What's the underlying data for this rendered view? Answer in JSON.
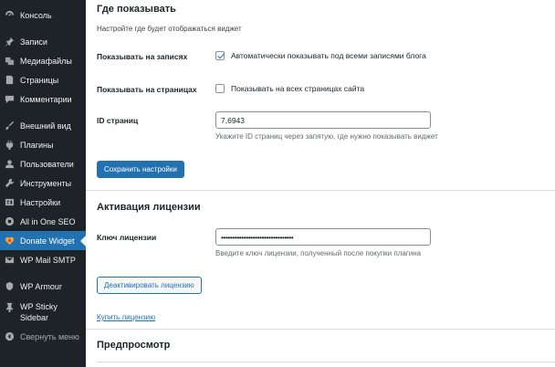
{
  "sidebar": {
    "items": [
      {
        "label": "Консоль",
        "icon": "dashboard-icon"
      },
      {
        "label": "Записи",
        "icon": "pin-icon"
      },
      {
        "label": "Медиафайлы",
        "icon": "media-icon"
      },
      {
        "label": "Страницы",
        "icon": "page-icon"
      },
      {
        "label": "Комментарии",
        "icon": "comment-icon"
      },
      {
        "label": "Внешний вид",
        "icon": "brush-icon"
      },
      {
        "label": "Плагины",
        "icon": "plugin-icon"
      },
      {
        "label": "Пользователи",
        "icon": "users-icon"
      },
      {
        "label": "Инструменты",
        "icon": "wrench-icon"
      },
      {
        "label": "Настройки",
        "icon": "settings-icon"
      },
      {
        "label": "All in One SEO",
        "icon": "seo-icon"
      },
      {
        "label": "Donate Widget",
        "icon": "heart-icon"
      },
      {
        "label": "WP Mail SMTP",
        "icon": "mail-icon"
      },
      {
        "label": "WP Armour",
        "icon": "shield-icon"
      },
      {
        "label": "WP Sticky Sidebar",
        "icon": "sticky-pin-icon"
      },
      {
        "label": "Свернуть меню",
        "icon": "collapse-icon"
      }
    ]
  },
  "display_section": {
    "title": "Где показывать",
    "description": "Настройте где будет отображаться виджет",
    "posts_label": "Показывать на записях",
    "posts_checkbox_text": "Автоматически показывать под всеми записями блога",
    "posts_checked": true,
    "pages_label": "Показывать на страницах",
    "pages_checkbox_text": "Показывать на всех страницах сайта",
    "pages_checked": false,
    "page_ids_label": "ID страниц",
    "page_ids_value": "7,6943",
    "page_ids_hint": "Укажите ID страниц через запятую, где нужно показывать виджет",
    "save_button": "Сохранить настройки"
  },
  "license_section": {
    "title": "Активация лицензии",
    "key_label": "Ключ лицензии",
    "key_value": "••••••••••••••••••••••••••••••••",
    "key_hint": "Введите ключ лицензии, полученный после покупки плагина",
    "deactivate_button": "Деактивировать лицензию",
    "buy_link": "Купить лицензию"
  },
  "preview_section": {
    "title": "Предпросмотр"
  },
  "colors": {
    "sidebar_bg": "#1d2327",
    "accent": "#2271b1"
  }
}
